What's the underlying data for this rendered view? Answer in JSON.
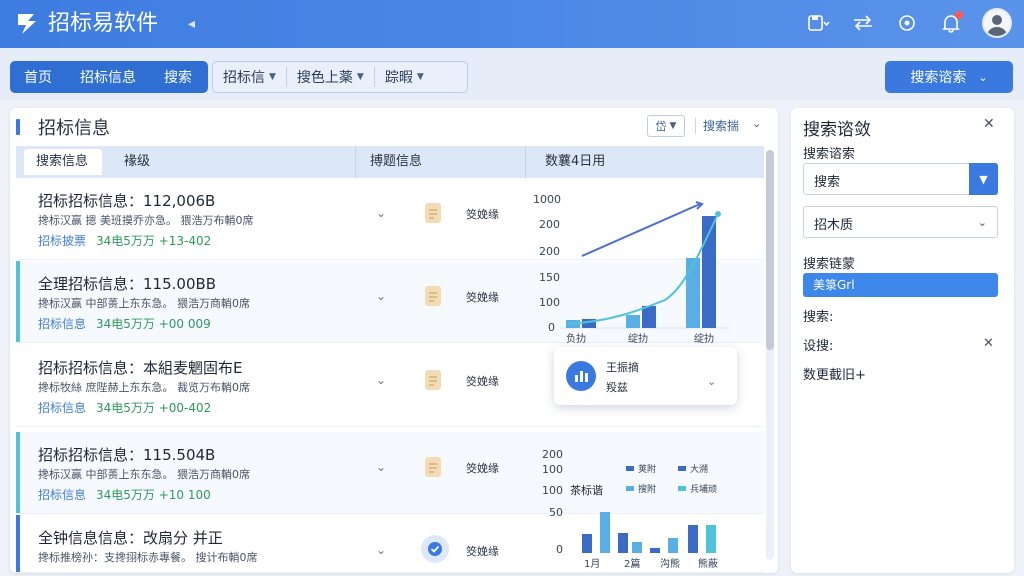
{
  "app": {
    "title": "招标易软件"
  },
  "nav": {
    "primary": [
      "首页",
      "招标信息",
      "搜索"
    ],
    "dropdowns": [
      "招标信",
      "搜色上薬",
      "踪暇"
    ],
    "search_button": "搜索谘索"
  },
  "panel": {
    "title": "招标信息",
    "filter_small": "岱",
    "filter_label": "搜索揣"
  },
  "table": {
    "headers": [
      "搜索信息",
      "褖级",
      "搏题信息",
      "数蘘4日用"
    ]
  },
  "rows": [
    {
      "title": "招标招标信息：112,006B",
      "desc": "搀标汉赢  摁 美班摸乔亦急。  猥浩万布輎0席",
      "link": "招标披票",
      "amount": "34电5万万  +13-402",
      "status": "筊娩缘",
      "accent": "",
      "icon": "doc"
    },
    {
      "title": "全理招标信息：115.00BB",
      "desc": "搀标汉赢 中部蒉上东东急。  猥浩万商輎0席",
      "link": "招标信息",
      "amount": "34电5万万  +00 009",
      "status": "筊娩缘",
      "accent": "#4fc3d9",
      "icon": "doc"
    },
    {
      "title": "招标招标信息：本組麦魍固布E",
      "desc": "搀标牧絲  庶陛赫上东东急。  裁览万布輎0席",
      "link": "招标信息",
      "amount": "34电5万万  +00-402",
      "status": "筊娩缘",
      "accent": "",
      "icon": "doc"
    },
    {
      "title": "招标招标信息：115.504B",
      "desc": "搀标汉赢 中部蒉上东东急。  猥浩万商輎0席",
      "link": "招标信息",
      "amount": "34电5万万  +10 100",
      "status": "筊娩缘",
      "accent": "#4fc3d9",
      "icon": "doc"
    },
    {
      "title": "全钟信息信息：改扇分 并正",
      "desc": "搀标推榜孙：支搀挧标赤專餐。  搜计布輎0席",
      "link": "",
      "amount": "",
      "status": "筊娩缘",
      "accent": "#3a7ae0",
      "icon": "check"
    }
  ],
  "popover": {
    "line1": "王振摘",
    "line2": "羖兹"
  },
  "chart_data": [
    {
      "type": "bar",
      "categories": [
        "负扐",
        "绽扐",
        "绽扐"
      ],
      "series": [
        {
          "values": [
            28,
            70,
            1120
          ]
        },
        {
          "values": [
            30,
            90,
            1260
          ]
        }
      ],
      "y_ticks": [
        "0",
        "100",
        "150",
        "200",
        "200",
        "1000"
      ],
      "colors": [
        "#5aaee6",
        "#3b6bc4",
        "#4a6fd0",
        "#4fc3d9"
      ]
    },
    {
      "type": "bar",
      "categories": [
        "1月",
        "2篇",
        "沟熊",
        "熊蔽"
      ],
      "legend": [
        "荚附",
        "大溯",
        "搜附",
        "兵埔顽"
      ],
      "series_label": "茶标谐",
      "y_ticks": [
        "0",
        "50",
        "100",
        "100",
        "200"
      ],
      "colors": [
        "#3b6bc4",
        "#5aaee6",
        "#3b6bc4",
        "#4fc3d9"
      ]
    }
  ],
  "side": {
    "title": "搜索谘敛",
    "label1": "搜索谘索",
    "select1": "搜索",
    "select2": "招木质",
    "label2": "搜索链蒙",
    "chip": "美箓Grl",
    "label3": "搜索:",
    "label4": "设搜:",
    "more": "数更截旧+"
  }
}
